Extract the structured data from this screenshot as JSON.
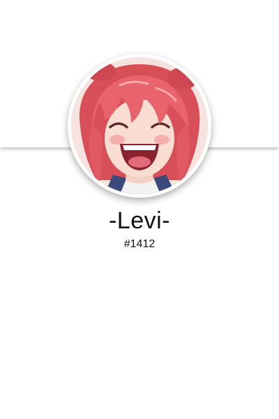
{
  "profile": {
    "display_name": "-Levi-",
    "tag": "#1412",
    "avatar_icon": "anime-girl-avatar"
  },
  "colors": {
    "background": "#ffffff",
    "text": "#111111",
    "avatar_hair": "#e65a62",
    "avatar_frame": "#ffffff"
  }
}
